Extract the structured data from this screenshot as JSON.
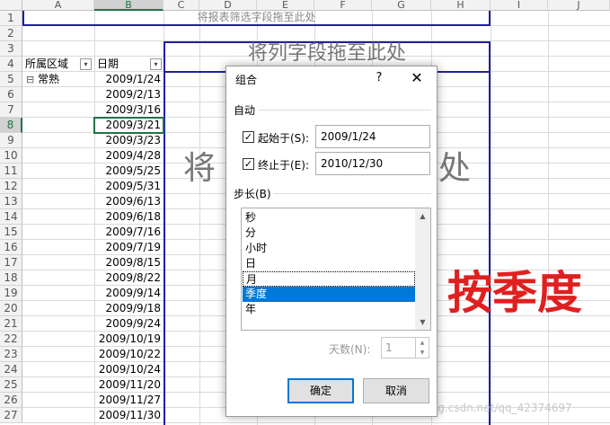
{
  "sheet": {
    "columns": [
      "A",
      "B",
      "C",
      "D",
      "E",
      "F",
      "G",
      "H",
      "I",
      "J"
    ],
    "selected_column": "B",
    "rows": [
      "1",
      "2",
      "3",
      "4",
      "5",
      "6",
      "7",
      "8",
      "9",
      "10",
      "11",
      "12",
      "13",
      "14",
      "15",
      "16",
      "17",
      "18",
      "19",
      "20",
      "21",
      "22",
      "23",
      "24",
      "25",
      "26",
      "27"
    ],
    "selected_row": "8",
    "filter_drop_zone": "将报表筛选字段拖至此处",
    "column_drop_zone": "将列字段拖至此处",
    "data_drop_zone_left": "将",
    "data_drop_zone_right": "处",
    "header_row": {
      "a": "所属区域",
      "b": "日期"
    },
    "region": {
      "expander": "⊟",
      "label": "常熟"
    },
    "dates": [
      "2009/1/24",
      "2009/2/13",
      "2009/3/16",
      "2009/3/21",
      "2009/3/23",
      "2009/4/28",
      "2009/5/25",
      "2009/5/31",
      "2009/6/13",
      "2009/6/18",
      "2009/7/16",
      "2009/7/19",
      "2009/8/15",
      "2009/8/22",
      "2009/9/14",
      "2009/9/18",
      "2009/9/24",
      "2009/10/19",
      "2009/10/22",
      "2009/10/24",
      "2009/11/20",
      "2009/11/27",
      "2009/11/30"
    ]
  },
  "dialog": {
    "title": "组合",
    "help": "?",
    "close": "✕",
    "auto_label": "自动",
    "start_label": "起始于(S):",
    "start_checked": "✓",
    "start_value": "2009/1/24",
    "end_label": "终止于(E):",
    "end_checked": "✓",
    "end_value": "2010/12/30",
    "step_label": "步长(B)",
    "step_items": [
      "秒",
      "分",
      "小时",
      "日",
      "月",
      "季度",
      "年"
    ],
    "selected_step": "季度",
    "days_label": "天数(N):",
    "days_value": "1",
    "ok_label": "确定",
    "cancel_label": "取消"
  },
  "annotation": "按季度",
  "watermark": "https://blog.csdn.net/qq_42374697",
  "colors": {
    "accent": "#217346",
    "selection_blue": "#0078d7",
    "annotation_red": "#e02020",
    "pivot_border": "#1f1fa0"
  }
}
